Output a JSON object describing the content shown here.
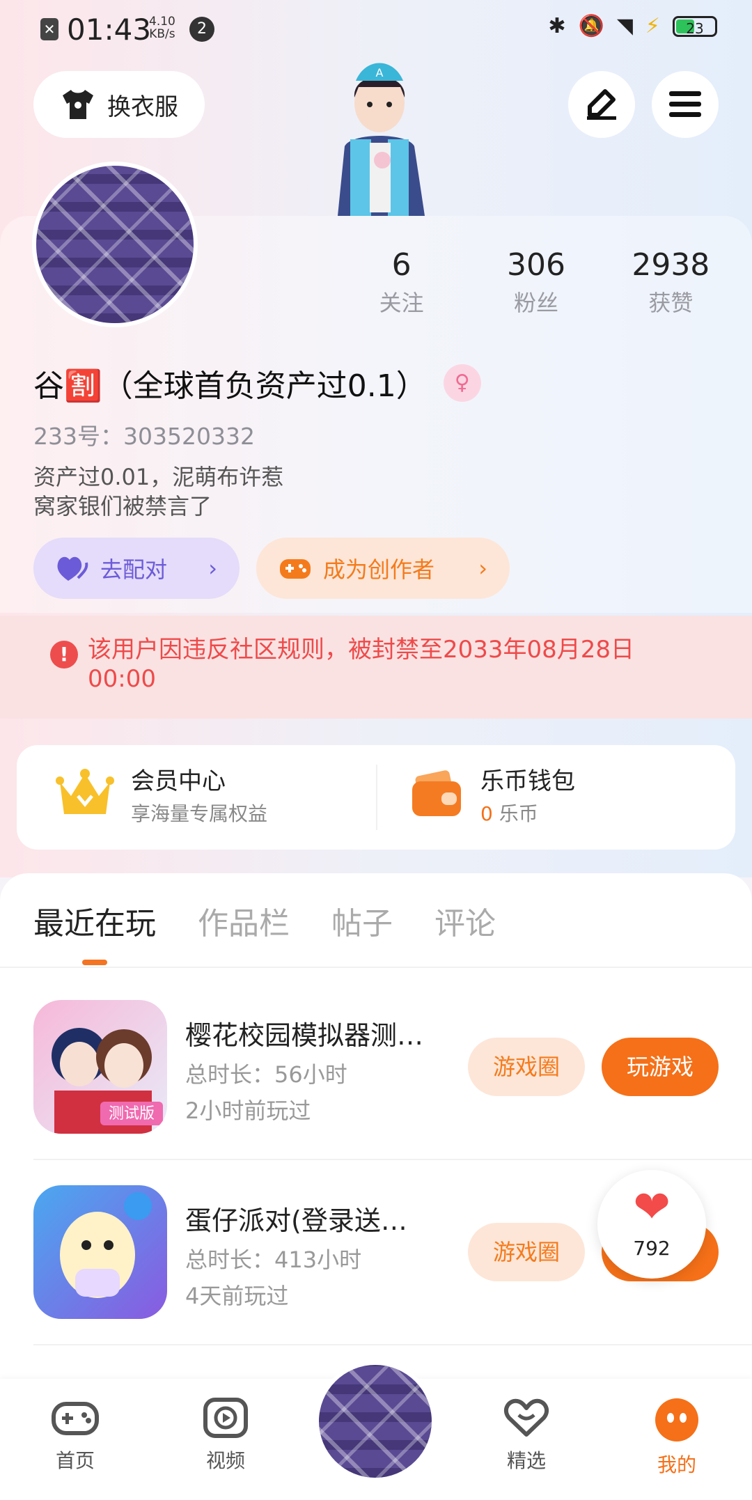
{
  "status_bar": {
    "time": "01:43",
    "speed_value": "4.10",
    "speed_unit": "KB/s",
    "notif_count": "2",
    "battery": "23"
  },
  "header": {
    "dress_up_label": "换衣服",
    "edit_icon": "pencil-icon",
    "menu_icon": "hamburger-menu-icon"
  },
  "profile": {
    "stats": [
      {
        "value": "6",
        "label": "关注"
      },
      {
        "value": "306",
        "label": "粉丝"
      },
      {
        "value": "2938",
        "label": "获赞"
      }
    ],
    "name": "谷🈹（全球首负资产过0.1）",
    "gender": "female",
    "uid": "233号：303520332",
    "bio_line1": "资产过0.01，泥萌布许惹",
    "bio_line2": "窝家银们被禁言了",
    "match_label": "去配对",
    "creator_label": "成为创作者"
  },
  "ban_notice": "该用户因违反社区规则，被封禁至2033年08月28日 00:00",
  "membership": {
    "title": "会员中心",
    "subtitle": "享海量专属权益"
  },
  "wallet": {
    "title": "乐币钱包",
    "amount": "0",
    "unit": "乐币"
  },
  "tabs": [
    "最近在玩",
    "作品栏",
    "帖子",
    "评论"
  ],
  "games": [
    {
      "title": "樱花校园模拟器测…",
      "duration": "总时长：56小时",
      "last_played": "2小时前玩过",
      "circle_label": "游戏圈",
      "play_label": "玩游戏",
      "badge": "测试版"
    },
    {
      "title": "蛋仔派对(登录送…",
      "duration": "总时长：413小时",
      "last_played": "4天前玩过",
      "circle_label": "游戏圈",
      "play_label": "玩游戏"
    }
  ],
  "like_count": "792",
  "bottom_nav": [
    {
      "label": "首页",
      "icon": "gamepad-icon"
    },
    {
      "label": "视频",
      "icon": "video-play-icon"
    },
    {
      "label": "精选",
      "icon": "heart-chat-icon"
    },
    {
      "label": "我的",
      "icon": "face-icon"
    }
  ],
  "colors": {
    "accent": "#f57018",
    "ban_text": "#ee4a4a",
    "match": "#6c5bd8"
  }
}
